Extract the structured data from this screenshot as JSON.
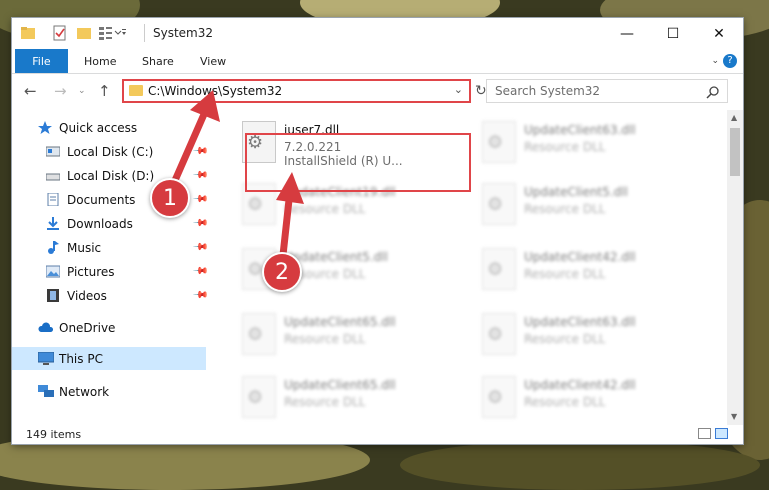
{
  "window": {
    "title": "System32",
    "minimize_glyph": "—",
    "maximize_glyph": "☐",
    "close_glyph": "✕"
  },
  "ribbon": {
    "tabs": [
      "File",
      "Home",
      "Share",
      "View"
    ],
    "help_glyph": "?"
  },
  "nav": {
    "address": "C:\\Windows\\System32",
    "search_placeholder": "Search System32"
  },
  "sidebar": {
    "items": [
      {
        "label": "Quick access",
        "icon": "star-icon",
        "pinned": false
      },
      {
        "label": "Local Disk (C:)",
        "icon": "drive-icon",
        "pinned": true
      },
      {
        "label": "Local Disk (D:)",
        "icon": "drive-icon",
        "pinned": true
      },
      {
        "label": "Documents",
        "icon": "documents-icon",
        "pinned": true
      },
      {
        "label": "Downloads",
        "icon": "downloads-icon",
        "pinned": true
      },
      {
        "label": "Music",
        "icon": "music-icon",
        "pinned": true
      },
      {
        "label": "Pictures",
        "icon": "pictures-icon",
        "pinned": true
      },
      {
        "label": "Videos",
        "icon": "videos-icon",
        "pinned": true
      },
      {
        "label": "OneDrive",
        "icon": "cloud-icon",
        "pinned": false
      },
      {
        "label": "This PC",
        "icon": "pc-icon",
        "pinned": false,
        "selected": true
      },
      {
        "label": "Network",
        "icon": "network-icon",
        "pinned": false
      }
    ]
  },
  "files": {
    "highlighted": {
      "name": "iuser7.dll",
      "version": "7.2.0.221",
      "description": "InstallShield (R) U..."
    },
    "left_column": [
      {
        "name": "UpdateClient19.dll",
        "type": "Resource DLL"
      },
      {
        "name": "UpdateClient5.dll",
        "type": "Resource DLL"
      },
      {
        "name": "UpdateClient65.dll",
        "type": "Resource DLL"
      },
      {
        "name": "UpdateClient65.dll",
        "type": "Resource DLL"
      }
    ],
    "right_column": [
      {
        "name": "UpdateClient63.dll",
        "type": "Resource DLL"
      },
      {
        "name": "UpdateClient5.dll",
        "type": "Resource DLL"
      },
      {
        "name": "UpdateClient42.dll",
        "type": "Resource DLL"
      },
      {
        "name": "UpdateClient63.dll",
        "type": "Resource DLL"
      },
      {
        "name": "UpdateClient42.dll",
        "type": "Resource DLL"
      }
    ]
  },
  "status": {
    "count": "149 items"
  },
  "annotations": {
    "badge_1": "1",
    "badge_2": "2",
    "color": "#d63b3f"
  }
}
